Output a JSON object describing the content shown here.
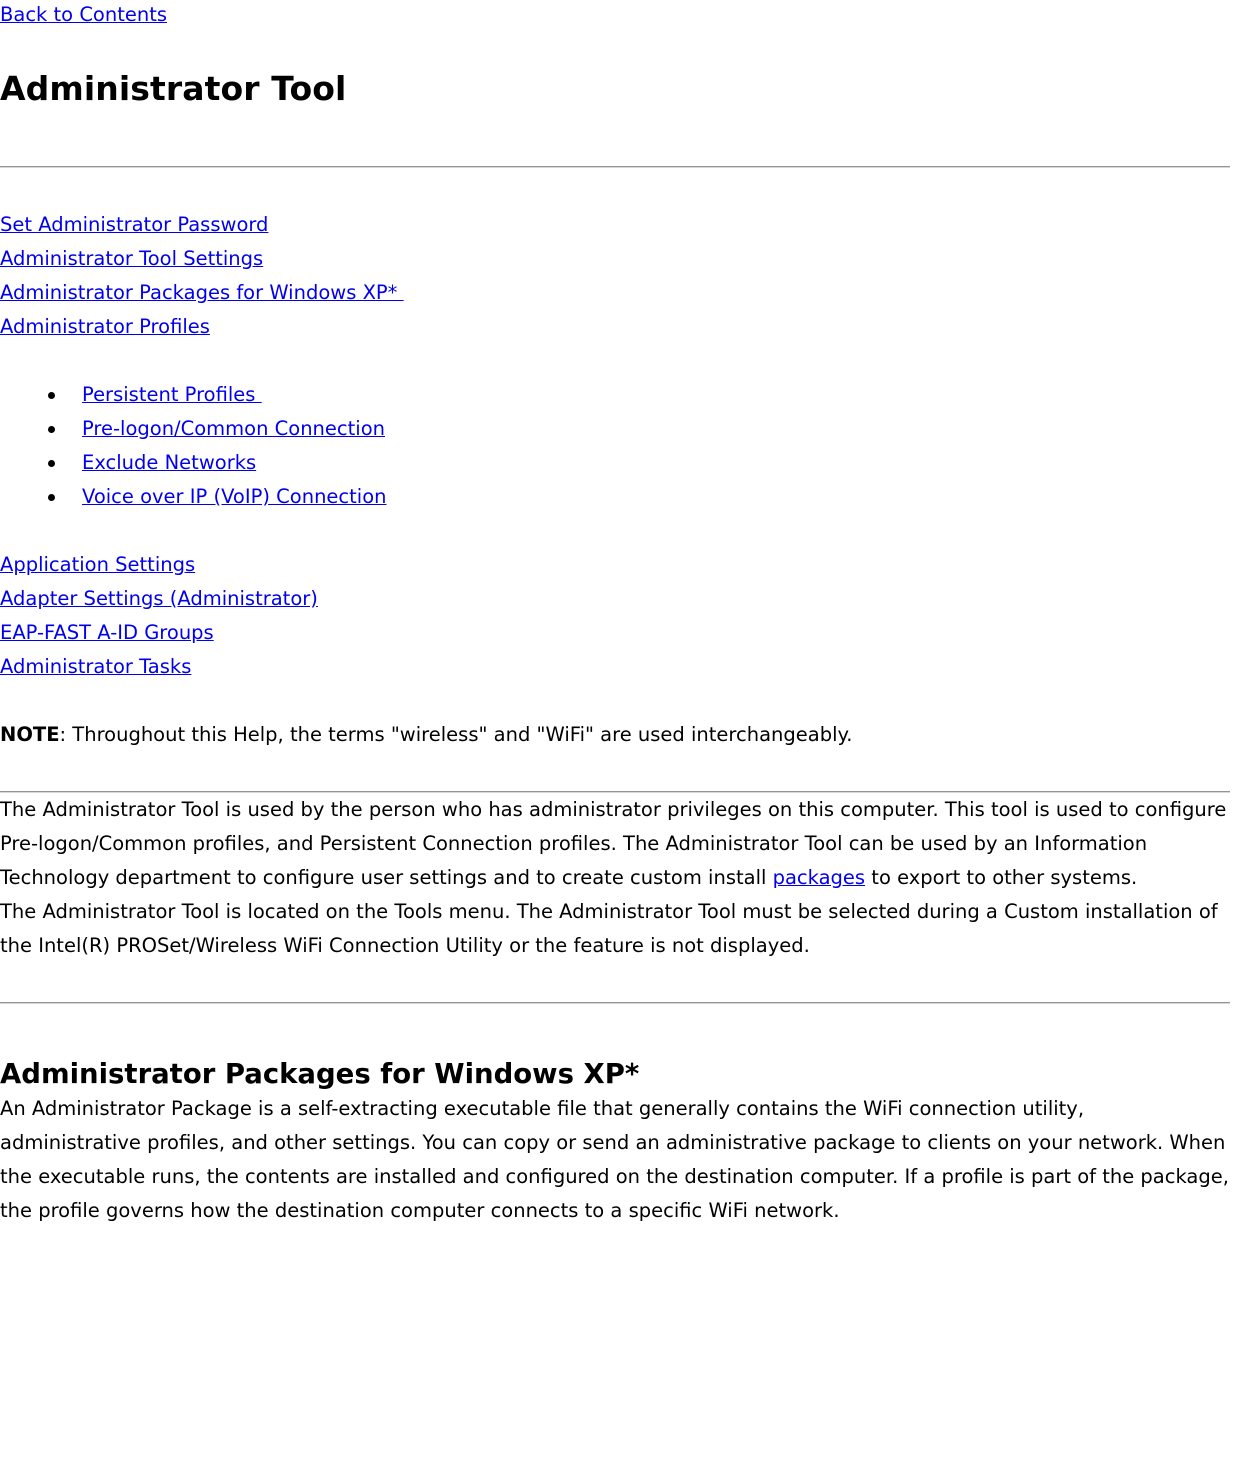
{
  "document": {
    "back_link": "Back to Contents",
    "title": "Administrator Tool"
  },
  "toc": {
    "primary_links": [
      "Set Administrator Password",
      "Administrator Tool Settings",
      "Administrator Packages for Windows XP* ",
      "Administrator Profiles"
    ],
    "profile_bullets": [
      "Persistent Profiles ",
      "Pre-logon/Common Connection",
      "Exclude Networks",
      "Voice over IP (VoIP) Connection"
    ],
    "secondary_links": [
      "Application Settings",
      "Adapter Settings (Administrator)",
      "EAP-FAST A-ID Groups",
      "Administrator Tasks"
    ]
  },
  "note": {
    "label": "NOTE",
    "text": ": Throughout this Help, the terms \"wireless\" and \"WiFi\" are used interchangeably."
  },
  "content": {
    "paragraph_1_before_link": "The Administrator Tool is used by the person who has administrator privileges on this computer. This tool is used to configure Pre-logon/Common profiles, and Persistent Connection profiles. The Administrator Tool can be used by an Information Technology department to configure user settings and to create custom install ",
    "paragraph_1_link": "packages",
    "paragraph_1_after_link": " to export to other systems.",
    "paragraph_2": "The Administrator Tool is located on the Tools menu. The Administrator Tool must be selected during a Custom installation of the Intel(R) PROSet/Wireless WiFi Connection Utility or the feature is not displayed.",
    "section_2_title": "Administrator Packages for Windows XP*",
    "paragraph_3": "An Administrator Package is a self-extracting executable file that generally contains the WiFi connection utility, administrative profiles, and other settings. You can copy or send an administrative package to clients on your network. When the executable runs, the contents are installed and configured on the destination computer. If a profile is part of the package, the profile governs how the destination computer connects to a specific WiFi network."
  },
  "colors": {
    "link": "#0000ee",
    "text": "#000000",
    "rule_top": "#949494",
    "rule_bottom": "#d8d8d8",
    "background": "#ffffff"
  }
}
